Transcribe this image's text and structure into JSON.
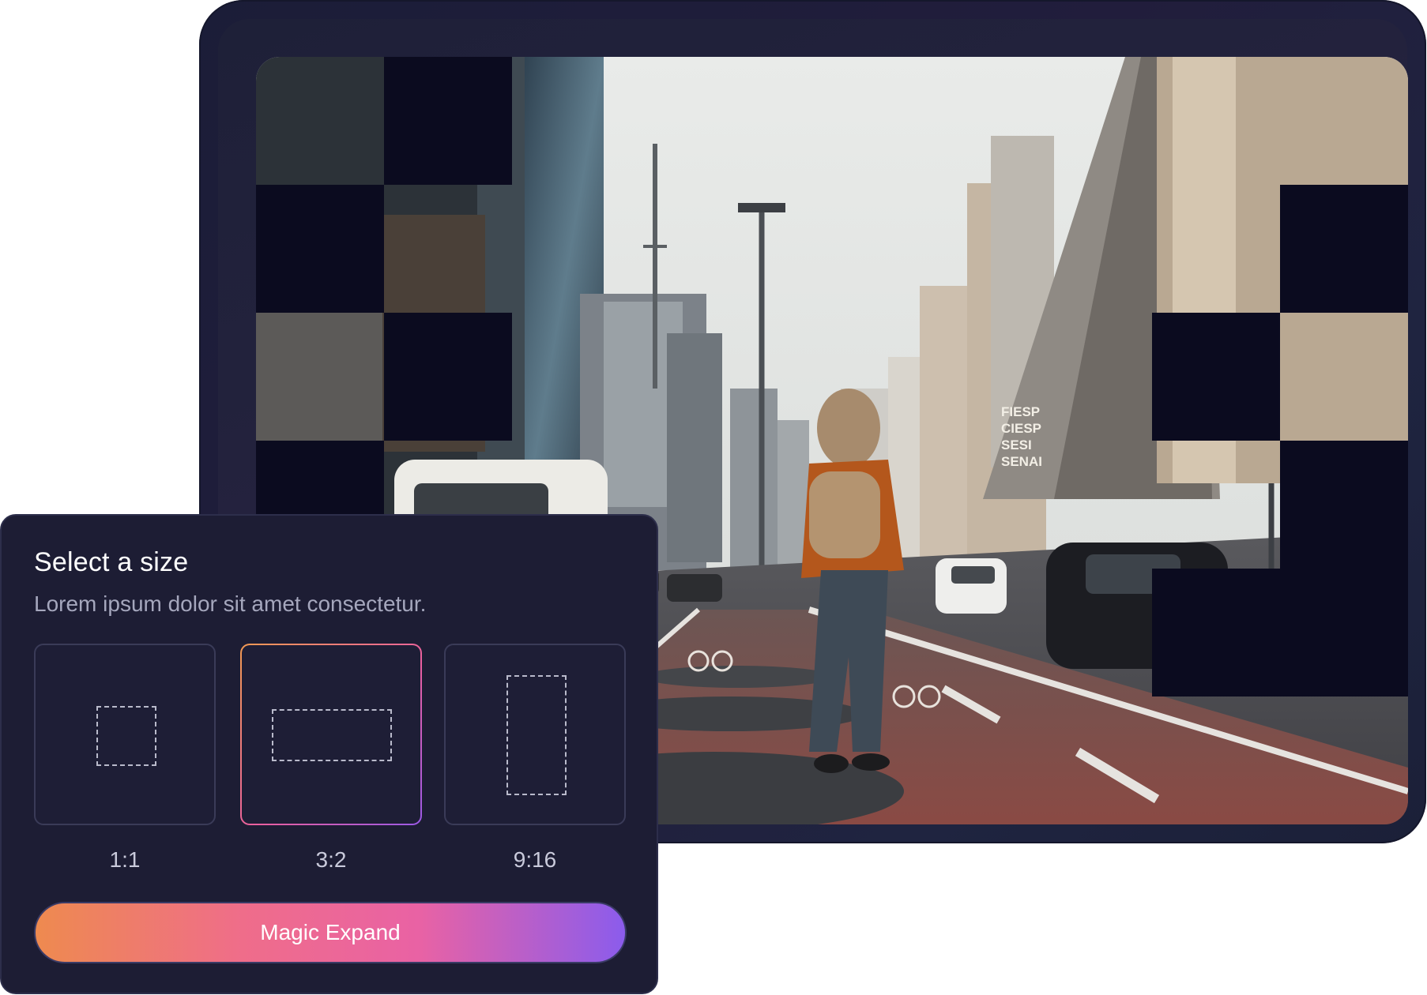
{
  "panel": {
    "title": "Select a size",
    "subtitle": "Lorem ipsum dolor sit amet consectetur.",
    "options": [
      {
        "label": "1:1",
        "selected": false
      },
      {
        "label": "3:2",
        "selected": true
      },
      {
        "label": "9:16",
        "selected": false
      }
    ],
    "action_label": "Magic Expand"
  },
  "photo": {
    "sign_lines": [
      "FIESP",
      "CIESP",
      "SESI",
      "SENAI"
    ]
  },
  "colors": {
    "panel_bg": "#1d1d34",
    "mask": "#0b0b1f",
    "accent_start": "#ee8a4f",
    "accent_mid": "#e962a4",
    "accent_end": "#8b5cec"
  }
}
